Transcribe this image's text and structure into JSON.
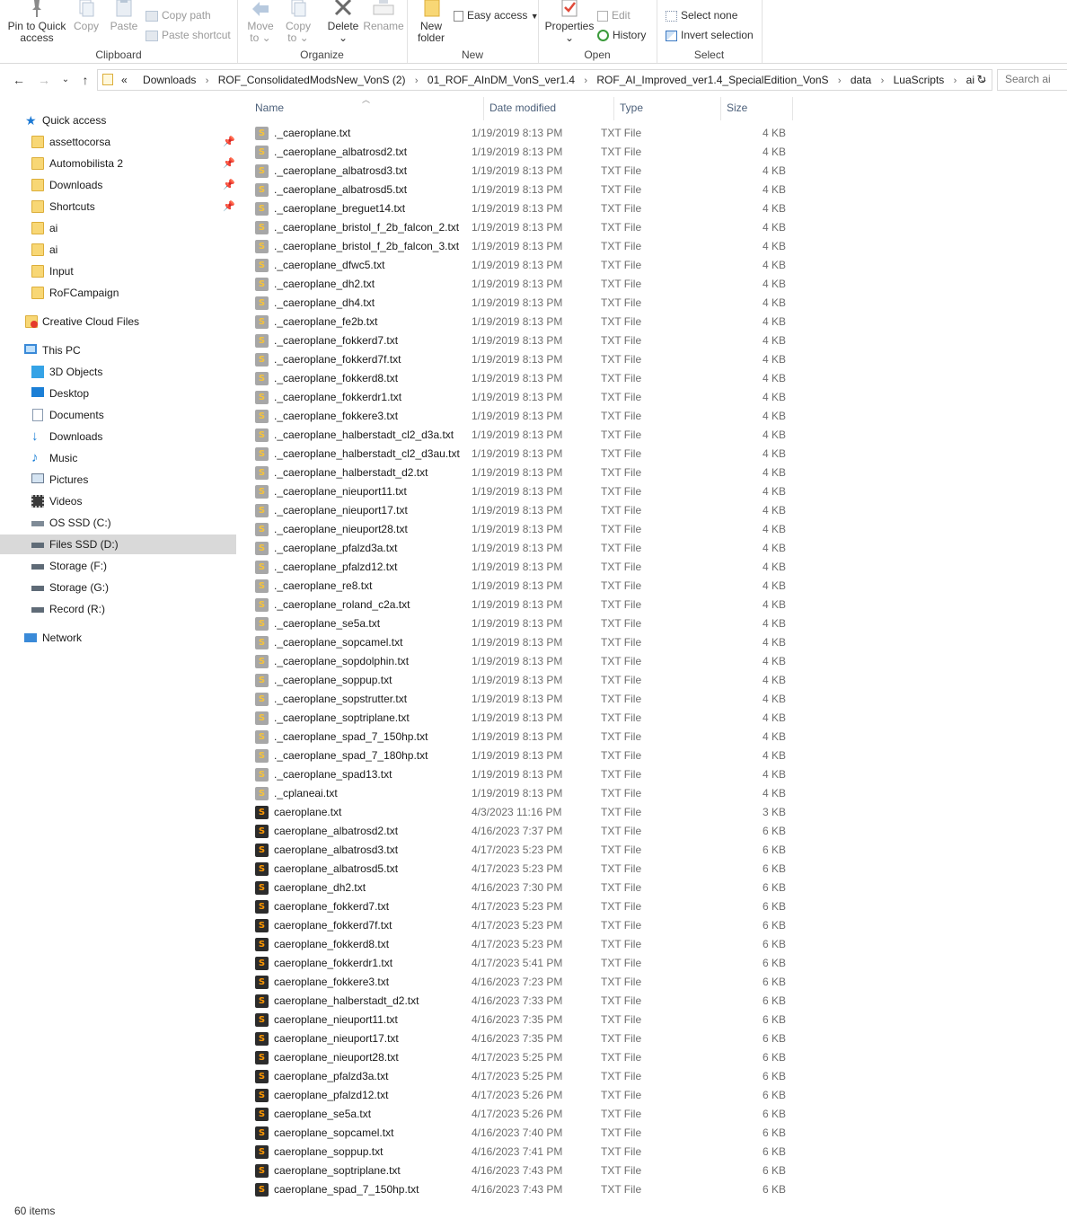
{
  "ribbon": {
    "clipboard": {
      "label": "Clipboard",
      "pin_label_1": "Pin to Quick",
      "pin_label_2": "access",
      "copy_label": "Copy",
      "paste_label": "Paste",
      "copy_path_label": "Copy path",
      "paste_shortcut_label": "Paste shortcut"
    },
    "organize": {
      "label": "Organize",
      "move_label_1": "Move",
      "move_label_2": "to",
      "copy_label_1": "Copy",
      "copy_label_2": "to",
      "delete_label": "Delete",
      "rename_label": "Rename"
    },
    "new": {
      "label": "New",
      "new_folder_1": "New",
      "new_folder_2": "folder",
      "easy_access_label": "Easy access"
    },
    "open": {
      "label": "Open",
      "properties_label": "Properties",
      "edit_label": "Edit",
      "history_label": "History"
    },
    "select": {
      "label": "Select",
      "select_none_label": "Select none",
      "invert_selection_label": "Invert selection"
    }
  },
  "address": {
    "overflow": "«",
    "crumbs": [
      "Downloads",
      "ROF_ConsolidatedModsNew_VonS (2)",
      "01_ROF_AInDM_VonS_ver1.4",
      "ROF_AI_Improved_ver1.4_SpecialEdition_VonS",
      "data",
      "LuaScripts",
      "ai"
    ],
    "search_placeholder": "Search ai"
  },
  "nav": {
    "quick_access": "Quick access",
    "quick_items": [
      "assettocorsa",
      "Automobilista 2",
      "Downloads",
      "Shortcuts",
      "ai",
      "ai",
      "Input",
      "RoFCampaign"
    ],
    "creative_cloud": "Creative Cloud Files",
    "this_pc": "This PC",
    "pc_items": [
      "3D Objects",
      "Desktop",
      "Documents",
      "Downloads",
      "Music",
      "Pictures",
      "Videos",
      "OS SSD (C:)",
      "Files SSD (D:)",
      "Storage (F:)",
      "Storage (G:)",
      "Record (R:)"
    ],
    "network": "Network"
  },
  "columns": {
    "name": "Name",
    "date": "Date modified",
    "type": "Type",
    "size": "Size"
  },
  "files": [
    {
      "name": "._caeroplane.txt",
      "date": "1/19/2019 8:13 PM",
      "type": "TXT File",
      "size": "4 KB",
      "icon": "light"
    },
    {
      "name": "._caeroplane_albatrosd2.txt",
      "date": "1/19/2019 8:13 PM",
      "type": "TXT File",
      "size": "4 KB",
      "icon": "light"
    },
    {
      "name": "._caeroplane_albatrosd3.txt",
      "date": "1/19/2019 8:13 PM",
      "type": "TXT File",
      "size": "4 KB",
      "icon": "light"
    },
    {
      "name": "._caeroplane_albatrosd5.txt",
      "date": "1/19/2019 8:13 PM",
      "type": "TXT File",
      "size": "4 KB",
      "icon": "light"
    },
    {
      "name": "._caeroplane_breguet14.txt",
      "date": "1/19/2019 8:13 PM",
      "type": "TXT File",
      "size": "4 KB",
      "icon": "light"
    },
    {
      "name": "._caeroplane_bristol_f_2b_falcon_2.txt",
      "date": "1/19/2019 8:13 PM",
      "type": "TXT File",
      "size": "4 KB",
      "icon": "light"
    },
    {
      "name": "._caeroplane_bristol_f_2b_falcon_3.txt",
      "date": "1/19/2019 8:13 PM",
      "type": "TXT File",
      "size": "4 KB",
      "icon": "light"
    },
    {
      "name": "._caeroplane_dfwc5.txt",
      "date": "1/19/2019 8:13 PM",
      "type": "TXT File",
      "size": "4 KB",
      "icon": "light"
    },
    {
      "name": "._caeroplane_dh2.txt",
      "date": "1/19/2019 8:13 PM",
      "type": "TXT File",
      "size": "4 KB",
      "icon": "light"
    },
    {
      "name": "._caeroplane_dh4.txt",
      "date": "1/19/2019 8:13 PM",
      "type": "TXT File",
      "size": "4 KB",
      "icon": "light"
    },
    {
      "name": "._caeroplane_fe2b.txt",
      "date": "1/19/2019 8:13 PM",
      "type": "TXT File",
      "size": "4 KB",
      "icon": "light"
    },
    {
      "name": "._caeroplane_fokkerd7.txt",
      "date": "1/19/2019 8:13 PM",
      "type": "TXT File",
      "size": "4 KB",
      "icon": "light"
    },
    {
      "name": "._caeroplane_fokkerd7f.txt",
      "date": "1/19/2019 8:13 PM",
      "type": "TXT File",
      "size": "4 KB",
      "icon": "light"
    },
    {
      "name": "._caeroplane_fokkerd8.txt",
      "date": "1/19/2019 8:13 PM",
      "type": "TXT File",
      "size": "4 KB",
      "icon": "light"
    },
    {
      "name": "._caeroplane_fokkerdr1.txt",
      "date": "1/19/2019 8:13 PM",
      "type": "TXT File",
      "size": "4 KB",
      "icon": "light"
    },
    {
      "name": "._caeroplane_fokkere3.txt",
      "date": "1/19/2019 8:13 PM",
      "type": "TXT File",
      "size": "4 KB",
      "icon": "light"
    },
    {
      "name": "._caeroplane_halberstadt_cl2_d3a.txt",
      "date": "1/19/2019 8:13 PM",
      "type": "TXT File",
      "size": "4 KB",
      "icon": "light"
    },
    {
      "name": "._caeroplane_halberstadt_cl2_d3au.txt",
      "date": "1/19/2019 8:13 PM",
      "type": "TXT File",
      "size": "4 KB",
      "icon": "light"
    },
    {
      "name": "._caeroplane_halberstadt_d2.txt",
      "date": "1/19/2019 8:13 PM",
      "type": "TXT File",
      "size": "4 KB",
      "icon": "light"
    },
    {
      "name": "._caeroplane_nieuport11.txt",
      "date": "1/19/2019 8:13 PM",
      "type": "TXT File",
      "size": "4 KB",
      "icon": "light"
    },
    {
      "name": "._caeroplane_nieuport17.txt",
      "date": "1/19/2019 8:13 PM",
      "type": "TXT File",
      "size": "4 KB",
      "icon": "light"
    },
    {
      "name": "._caeroplane_nieuport28.txt",
      "date": "1/19/2019 8:13 PM",
      "type": "TXT File",
      "size": "4 KB",
      "icon": "light"
    },
    {
      "name": "._caeroplane_pfalzd3a.txt",
      "date": "1/19/2019 8:13 PM",
      "type": "TXT File",
      "size": "4 KB",
      "icon": "light"
    },
    {
      "name": "._caeroplane_pfalzd12.txt",
      "date": "1/19/2019 8:13 PM",
      "type": "TXT File",
      "size": "4 KB",
      "icon": "light"
    },
    {
      "name": "._caeroplane_re8.txt",
      "date": "1/19/2019 8:13 PM",
      "type": "TXT File",
      "size": "4 KB",
      "icon": "light"
    },
    {
      "name": "._caeroplane_roland_c2a.txt",
      "date": "1/19/2019 8:13 PM",
      "type": "TXT File",
      "size": "4 KB",
      "icon": "light"
    },
    {
      "name": "._caeroplane_se5a.txt",
      "date": "1/19/2019 8:13 PM",
      "type": "TXT File",
      "size": "4 KB",
      "icon": "light"
    },
    {
      "name": "._caeroplane_sopcamel.txt",
      "date": "1/19/2019 8:13 PM",
      "type": "TXT File",
      "size": "4 KB",
      "icon": "light"
    },
    {
      "name": "._caeroplane_sopdolphin.txt",
      "date": "1/19/2019 8:13 PM",
      "type": "TXT File",
      "size": "4 KB",
      "icon": "light"
    },
    {
      "name": "._caeroplane_soppup.txt",
      "date": "1/19/2019 8:13 PM",
      "type": "TXT File",
      "size": "4 KB",
      "icon": "light"
    },
    {
      "name": "._caeroplane_sopstrutter.txt",
      "date": "1/19/2019 8:13 PM",
      "type": "TXT File",
      "size": "4 KB",
      "icon": "light"
    },
    {
      "name": "._caeroplane_soptriplane.txt",
      "date": "1/19/2019 8:13 PM",
      "type": "TXT File",
      "size": "4 KB",
      "icon": "light"
    },
    {
      "name": "._caeroplane_spad_7_150hp.txt",
      "date": "1/19/2019 8:13 PM",
      "type": "TXT File",
      "size": "4 KB",
      "icon": "light"
    },
    {
      "name": "._caeroplane_spad_7_180hp.txt",
      "date": "1/19/2019 8:13 PM",
      "type": "TXT File",
      "size": "4 KB",
      "icon": "light"
    },
    {
      "name": "._caeroplane_spad13.txt",
      "date": "1/19/2019 8:13 PM",
      "type": "TXT File",
      "size": "4 KB",
      "icon": "light"
    },
    {
      "name": "._cplaneai.txt",
      "date": "1/19/2019 8:13 PM",
      "type": "TXT File",
      "size": "4 KB",
      "icon": "light"
    },
    {
      "name": "caeroplane.txt",
      "date": "4/3/2023 11:16 PM",
      "type": "TXT File",
      "size": "3 KB",
      "icon": "dark"
    },
    {
      "name": "caeroplane_albatrosd2.txt",
      "date": "4/16/2023 7:37 PM",
      "type": "TXT File",
      "size": "6 KB",
      "icon": "dark"
    },
    {
      "name": "caeroplane_albatrosd3.txt",
      "date": "4/17/2023 5:23 PM",
      "type": "TXT File",
      "size": "6 KB",
      "icon": "dark"
    },
    {
      "name": "caeroplane_albatrosd5.txt",
      "date": "4/17/2023 5:23 PM",
      "type": "TXT File",
      "size": "6 KB",
      "icon": "dark"
    },
    {
      "name": "caeroplane_dh2.txt",
      "date": "4/16/2023 7:30 PM",
      "type": "TXT File",
      "size": "6 KB",
      "icon": "dark"
    },
    {
      "name": "caeroplane_fokkerd7.txt",
      "date": "4/17/2023 5:23 PM",
      "type": "TXT File",
      "size": "6 KB",
      "icon": "dark"
    },
    {
      "name": "caeroplane_fokkerd7f.txt",
      "date": "4/17/2023 5:23 PM",
      "type": "TXT File",
      "size": "6 KB",
      "icon": "dark"
    },
    {
      "name": "caeroplane_fokkerd8.txt",
      "date": "4/17/2023 5:23 PM",
      "type": "TXT File",
      "size": "6 KB",
      "icon": "dark"
    },
    {
      "name": "caeroplane_fokkerdr1.txt",
      "date": "4/17/2023 5:41 PM",
      "type": "TXT File",
      "size": "6 KB",
      "icon": "dark"
    },
    {
      "name": "caeroplane_fokkere3.txt",
      "date": "4/16/2023 7:23 PM",
      "type": "TXT File",
      "size": "6 KB",
      "icon": "dark"
    },
    {
      "name": "caeroplane_halberstadt_d2.txt",
      "date": "4/16/2023 7:33 PM",
      "type": "TXT File",
      "size": "6 KB",
      "icon": "dark"
    },
    {
      "name": "caeroplane_nieuport11.txt",
      "date": "4/16/2023 7:35 PM",
      "type": "TXT File",
      "size": "6 KB",
      "icon": "dark"
    },
    {
      "name": "caeroplane_nieuport17.txt",
      "date": "4/16/2023 7:35 PM",
      "type": "TXT File",
      "size": "6 KB",
      "icon": "dark"
    },
    {
      "name": "caeroplane_nieuport28.txt",
      "date": "4/17/2023 5:25 PM",
      "type": "TXT File",
      "size": "6 KB",
      "icon": "dark"
    },
    {
      "name": "caeroplane_pfalzd3a.txt",
      "date": "4/17/2023 5:25 PM",
      "type": "TXT File",
      "size": "6 KB",
      "icon": "dark"
    },
    {
      "name": "caeroplane_pfalzd12.txt",
      "date": "4/17/2023 5:26 PM",
      "type": "TXT File",
      "size": "6 KB",
      "icon": "dark"
    },
    {
      "name": "caeroplane_se5a.txt",
      "date": "4/17/2023 5:26 PM",
      "type": "TXT File",
      "size": "6 KB",
      "icon": "dark"
    },
    {
      "name": "caeroplane_sopcamel.txt",
      "date": "4/16/2023 7:40 PM",
      "type": "TXT File",
      "size": "6 KB",
      "icon": "dark"
    },
    {
      "name": "caeroplane_soppup.txt",
      "date": "4/16/2023 7:41 PM",
      "type": "TXT File",
      "size": "6 KB",
      "icon": "dark"
    },
    {
      "name": "caeroplane_soptriplane.txt",
      "date": "4/16/2023 7:43 PM",
      "type": "TXT File",
      "size": "6 KB",
      "icon": "dark"
    },
    {
      "name": "caeroplane_spad_7_150hp.txt",
      "date": "4/16/2023 7:43 PM",
      "type": "TXT File",
      "size": "6 KB",
      "icon": "dark"
    }
  ],
  "status": {
    "item_count": "60 items"
  },
  "colors": {
    "selected_nav": "#d9d9d9",
    "header_text": "#4c607a",
    "folder": "#f8d775",
    "sublime_orange": "#ff9800"
  }
}
